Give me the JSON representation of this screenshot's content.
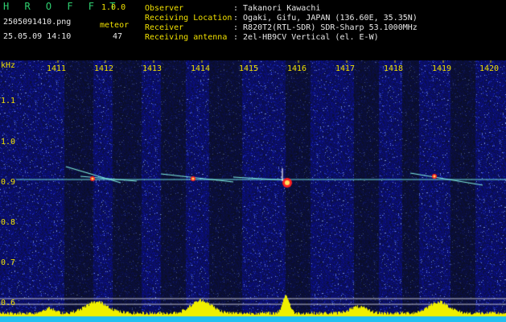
{
  "header": {
    "app_title": "H R O F F T",
    "version": "1.0.0",
    "filename": "2505091410.png",
    "datetime": "25.05.09 14:10",
    "meteor_label": "meteor",
    "meteor_count": "47",
    "observer_label": "Observer",
    "observer_value": ": Takanori Kawachi",
    "location_label": "Receiving Location",
    "location_value": ": Ogaki, Gifu, JAPAN (136.60E, 35.35N)",
    "receiver_label": "Receiver",
    "receiver_value": ": R820T2(RTL-SDR) SDR-Sharp 53.1000MHz",
    "antenna_label": "Receiving antenna",
    "antenna_value": ": 2el-HB9CV Vertical (el. E-W)"
  },
  "axes": {
    "y_unit": "kHz",
    "y_ticks": [
      "1.1",
      "1.0",
      "0.9",
      "0.8",
      "0.7",
      "0.6"
    ],
    "x_ticks": [
      "1411",
      "1412",
      "1413",
      "1414",
      "1415",
      "1416",
      "1417",
      "1418",
      "1419",
      "1420"
    ]
  },
  "colors": {
    "background": "#000000",
    "spectrum_base": "#10187a",
    "signal_line": "#6fe0e0",
    "meteor_head": "#ff2020",
    "level_bar": "#f0f000",
    "baseline": "#20c0f0"
  }
}
